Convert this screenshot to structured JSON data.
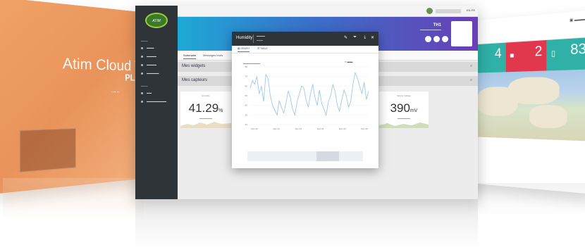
{
  "left_screen": {
    "title": "Atim Cloud Wi",
    "subtitle": "PLA"
  },
  "right_screen": {
    "tiles": [
      {
        "value": "4",
        "color": "#2fb1a8"
      },
      {
        "value": "2",
        "color": "#e1384e"
      },
      {
        "value": "83",
        "color": "#2fb1a8"
      }
    ]
  },
  "app": {
    "logo_text": "ATIM",
    "topbar": {
      "lang": "EN FR"
    },
    "device": {
      "name": "TH1"
    },
    "tabs": [
      "Sommaire",
      "Messages bruts"
    ],
    "sections": {
      "widgets": "Mes widgets",
      "sensors": "Mes capteurs"
    },
    "widgets": [
      {
        "title": "Humidity",
        "value": "41.29",
        "unit": "%"
      },
      {
        "title": "Supply Voltage",
        "value": "390",
        "unit": "mV"
      }
    ]
  },
  "modal": {
    "title": "Humidity",
    "tabs": [
      "GRAPH",
      "TABLE"
    ],
    "chart_data": {
      "type": "line",
      "title": "",
      "xlabel": "",
      "ylabel": "",
      "x_ticks": [
        "Dec 20",
        "Dec 21",
        "Dec 22",
        "Dec 23",
        "Dec 24",
        "Dec 25"
      ],
      "y_ticks": [
        "20",
        "30",
        "40",
        "50",
        "60",
        "70",
        "80"
      ],
      "ylim": [
        20,
        80
      ],
      "grid": true,
      "series": [
        {
          "color": "#9cc9e8",
          "values": [
            58,
            66,
            62,
            70,
            52,
            60,
            44,
            72,
            68,
            50,
            40,
            35,
            30,
            45,
            38,
            32,
            42,
            55,
            48,
            36,
            30,
            44,
            52,
            60,
            58,
            46,
            38,
            52,
            62,
            48,
            40,
            56,
            42,
            36,
            30,
            44,
            50,
            62,
            54,
            40,
            34,
            46,
            56,
            50,
            38,
            44,
            62,
            74,
            68,
            60,
            52,
            64,
            46,
            55
          ]
        }
      ]
    }
  }
}
